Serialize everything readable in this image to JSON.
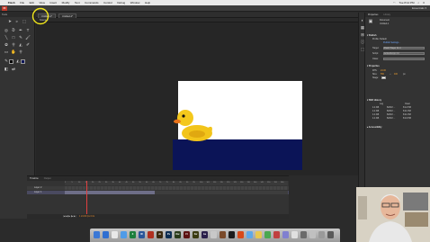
{
  "menubar": {
    "apple": "",
    "items": [
      "Flash",
      "File",
      "Edit",
      "View",
      "Insert",
      "Modify",
      "Text",
      "Commands",
      "Control",
      "Debug",
      "Window",
      "Help"
    ],
    "time": "Tue 8:14 PM"
  },
  "appbar": {
    "logo": "Fl",
    "workspace": "Essentials ▾"
  },
  "tools": {
    "header": "Tools"
  },
  "tabs": [
    "Untitled-1*",
    "Untitled-2*"
  ],
  "editbar": {
    "scene": "Scene 1"
  },
  "timeline": {
    "tabs": [
      "Timeline",
      "Output"
    ],
    "layers": [
      "Layer 2",
      "Layer 1"
    ],
    "ticks": [
      "1",
      "5",
      "10",
      "15",
      "20",
      "25",
      "30",
      "35",
      "40",
      "45",
      "50",
      "55",
      "60",
      "65",
      "70",
      "75",
      "80",
      "85",
      "90",
      "95",
      "100",
      "105",
      "110",
      "115",
      "120",
      "125",
      "130",
      "135",
      "140",
      "145",
      "150",
      "155",
      "160"
    ],
    "controls": "|◀  ◀|  ▶  |▶  ▶|",
    "status": "1   24.00 fps   0.0s"
  },
  "properties": {
    "tabs": [
      "Properties",
      "Library"
    ],
    "doc_type": "Document",
    "doc_name": "Untitled-1",
    "publish_header": "▾ Publish",
    "profile": "Profile: Default",
    "publish_settings": "Publish Settings...",
    "target_label": "Target:",
    "target": "Flash Player 11.4",
    "script_label": "Script:",
    "script": "ActionScript 3.0",
    "class_label": "Class:",
    "props_header": "▾ Properties",
    "fps_label": "FPS:",
    "fps": "24.00",
    "size_label": "Size:",
    "width": "550",
    "height": "400",
    "unit": "px",
    "stage_label": "Stage:",
    "swf_header": "▾ SWF History",
    "swf_cols": [
      "Log",
      "Clear"
    ],
    "swf_rows": [
      [
        "4.4 KB",
        "8/25/2 ...",
        "8:12 PM"
      ],
      [
        "4.4 KB",
        "8/25/2 ...",
        "8:11 PM"
      ],
      [
        "4.4 KB",
        "8/25/2 ...",
        "8:11 PM"
      ],
      [
        "4.4 KB",
        "8/25/2 ...",
        "8:10 PM"
      ]
    ],
    "access_header": "▸ Accessibility"
  },
  "dock": {
    "apps": [
      {
        "label": "",
        "color": "#3a78d6"
      },
      {
        "label": "",
        "color": "#2f6fd1"
      },
      {
        "label": "",
        "color": "#e8e8e8"
      },
      {
        "label": "",
        "color": "#4f9be8"
      },
      {
        "label": "X",
        "color": "#1d7f3c"
      },
      {
        "label": "W",
        "color": "#2b579a"
      },
      {
        "label": "",
        "color": "#b03020"
      },
      {
        "label": "Ai",
        "color": "#3a2a10"
      },
      {
        "label": "Ps",
        "color": "#0c2d52"
      },
      {
        "label": "Dw",
        "color": "#2a3b1a"
      },
      {
        "label": "Fl",
        "color": "#5c1212"
      },
      {
        "label": "Fw",
        "color": "#3a3a10"
      },
      {
        "label": "Ae",
        "color": "#2a1f4a"
      },
      {
        "label": "",
        "color": "#c8c8c8"
      },
      {
        "label": "",
        "color": "#7a4a2a"
      },
      {
        "label": "",
        "color": "#1c1c1c"
      },
      {
        "label": "",
        "color": "#d84a1a"
      },
      {
        "label": "",
        "color": "#5fa8e8"
      },
      {
        "label": "",
        "color": "#e8c850"
      },
      {
        "label": "",
        "color": "#4aa850"
      },
      {
        "label": "",
        "color": "#c04040"
      },
      {
        "label": "",
        "color": "#8080d0"
      },
      {
        "label": "",
        "color": "#e0e0e0"
      },
      {
        "label": "",
        "color": "#6a6a6a"
      },
      {
        "label": "",
        "color": "#c0c0c0"
      },
      {
        "label": "",
        "color": "#9a9a9a"
      },
      {
        "label": "",
        "color": "#5a5a5a"
      }
    ]
  },
  "colors": {
    "stage": "#ffffff",
    "water": "#0b1457",
    "duck": "#f2c41a",
    "highlight": "#f1e61b"
  }
}
